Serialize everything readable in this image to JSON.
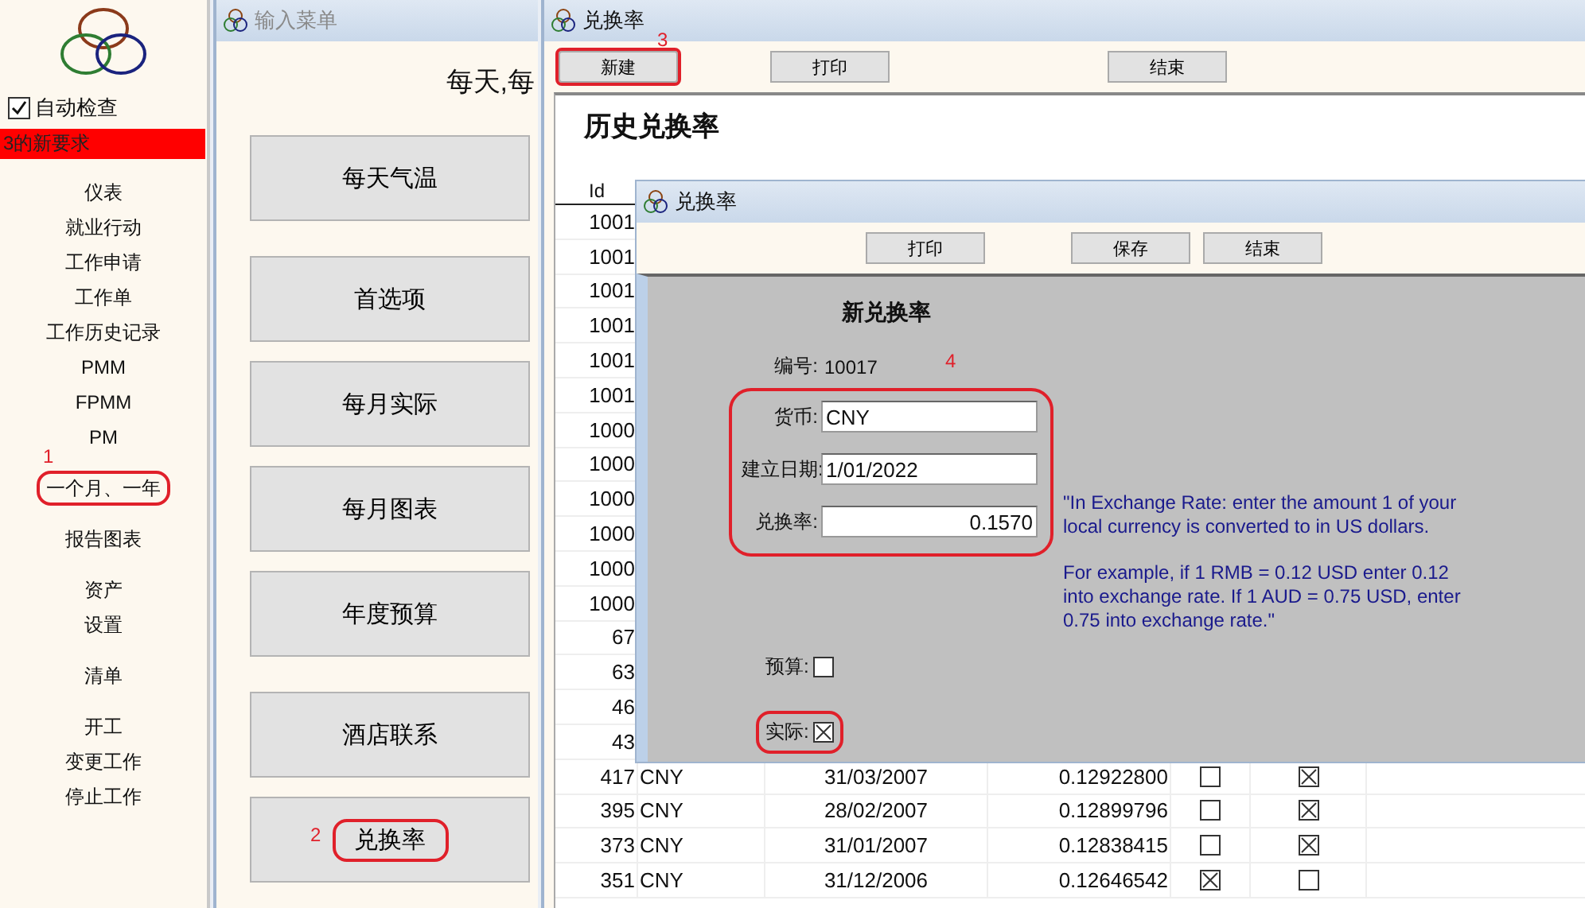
{
  "sidebar": {
    "auto_check": {
      "label": "自动检查",
      "checked": true
    },
    "alert": "3的新要求",
    "menu_groups": [
      [
        {
          "label": "仪表",
          "highlighted": false
        },
        {
          "label": "就业行动",
          "highlighted": false
        },
        {
          "label": "工作申请",
          "highlighted": false
        },
        {
          "label": "工作单",
          "highlighted": false
        },
        {
          "label": "工作历史记录",
          "highlighted": false
        },
        {
          "label": "PMM",
          "highlighted": false
        },
        {
          "label": "FPMM",
          "highlighted": false
        },
        {
          "label": "PM",
          "highlighted": false
        }
      ],
      [
        {
          "label": "一个月、一年",
          "highlighted": true,
          "callout": "1"
        }
      ],
      [
        {
          "label": "报告图表",
          "highlighted": false
        }
      ],
      [
        {
          "label": "资产",
          "highlighted": false
        },
        {
          "label": "设置",
          "highlighted": false
        }
      ],
      [
        {
          "label": "清单",
          "highlighted": false
        }
      ],
      [
        {
          "label": "开工",
          "highlighted": false
        },
        {
          "label": "变更工作",
          "highlighted": false
        },
        {
          "label": "停止工作",
          "highlighted": false
        }
      ]
    ]
  },
  "menu_window": {
    "title": "输入菜单",
    "header": "每天,每",
    "button_groups": [
      [
        {
          "label": "每天气温",
          "highlighted": false
        }
      ],
      [
        {
          "label": "首选项",
          "highlighted": false
        },
        {
          "label": "每月实际",
          "highlighted": false
        },
        {
          "label": "每月图表",
          "highlighted": false
        },
        {
          "label": "年度预算",
          "highlighted": false
        }
      ],
      [
        {
          "label": "酒店联系",
          "highlighted": false
        },
        {
          "label": "兑换率",
          "highlighted": true,
          "callout": "2"
        }
      ]
    ]
  },
  "rate_window": {
    "title": "兑换率",
    "toolbar": [
      {
        "label": "新建",
        "highlighted": true,
        "callout": "3"
      },
      {
        "label": "打印",
        "highlighted": false
      },
      {
        "label": "结束",
        "highlighted": false
      }
    ],
    "heading": "历史兑换率",
    "table": {
      "columns": [
        "Id"
      ],
      "rows": [
        {
          "id": "1001"
        },
        {
          "id": "1001"
        },
        {
          "id": "1001"
        },
        {
          "id": "1001"
        },
        {
          "id": "1001"
        },
        {
          "id": "1001"
        },
        {
          "id": "1000"
        },
        {
          "id": "1000"
        },
        {
          "id": "1000"
        },
        {
          "id": "1000"
        },
        {
          "id": "1000"
        },
        {
          "id": "1000"
        },
        {
          "id": "67"
        },
        {
          "id": "63"
        },
        {
          "id": "46"
        },
        {
          "id": "43"
        },
        {
          "id": "417",
          "currency": "CNY",
          "date": "31/03/2007",
          "rate": "0.12922800",
          "budget": false,
          "actual": true
        },
        {
          "id": "395",
          "currency": "CNY",
          "date": "28/02/2007",
          "rate": "0.12899796",
          "budget": false,
          "actual": true
        },
        {
          "id": "373",
          "currency": "CNY",
          "date": "31/01/2007",
          "rate": "0.12838415",
          "budget": false,
          "actual": true
        },
        {
          "id": "351",
          "currency": "CNY",
          "date": "31/12/2006",
          "rate": "0.12646542",
          "budget": true,
          "actual": false
        }
      ]
    }
  },
  "dialog": {
    "title": "兑换率",
    "toolbar": [
      "打印",
      "保存",
      "结束"
    ],
    "heading": "新兑换率",
    "number": {
      "label": "编号:",
      "value": "10017"
    },
    "fields_highlighted": true,
    "fields_callout": "4",
    "fields": [
      {
        "label": "货币:",
        "value": "CNY",
        "kind": "text"
      },
      {
        "label": "建立日期:",
        "value": "1/01/2022",
        "kind": "text"
      },
      {
        "label": "兑换率:",
        "value": "0.1570",
        "kind": "number"
      }
    ],
    "help": [
      "\"In Exchange Rate: enter the amount 1 of your local currency is converted to in US dollars.",
      "For example, if 1 RMB = 0.12 USD enter 0.12 into exchange rate.  If 1 AUD = 0.75  USD, enter 0.75 into exchange rate.\""
    ],
    "checks": [
      {
        "label": "预算:",
        "checked": false,
        "highlighted": false
      },
      {
        "label": "实际:",
        "checked": true,
        "highlighted": true
      }
    ]
  }
}
